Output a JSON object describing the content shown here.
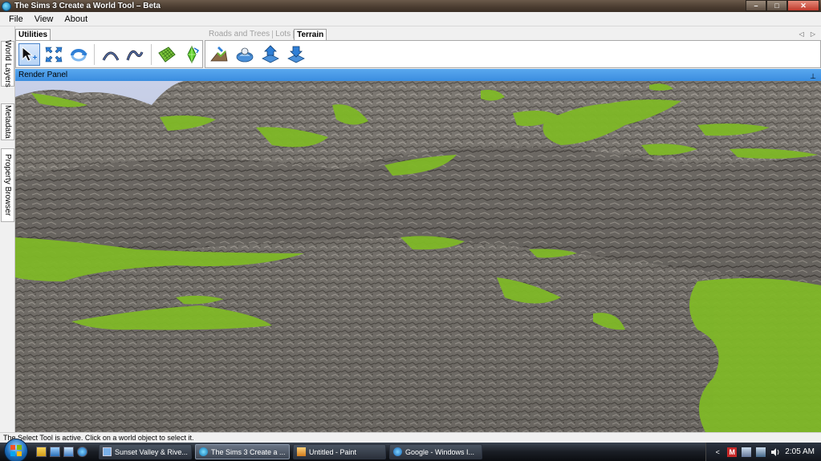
{
  "window": {
    "title": "The Sims 3 Create a World Tool – Beta",
    "controls": {
      "minimize": "–",
      "maximize": "□",
      "close": "✕"
    }
  },
  "menu": {
    "items": [
      "File",
      "View",
      "About"
    ]
  },
  "side_tabs": [
    "World Layers",
    "Metadata",
    "Property Browser"
  ],
  "toolbar": {
    "utilities_tab": "Utilities",
    "tabs": [
      "Roads and Trees",
      "Lots",
      "Terrain"
    ],
    "active_tab": "Terrain",
    "scroll_arrows": "◁ ▷",
    "utility_tools": [
      "select-tool-icon",
      "move-tool-icon",
      "rotate-tool-icon",
      "undo-curve-icon",
      "redo-curve-icon",
      "grid-tool-icon",
      "sim-tool-icon"
    ],
    "terrain_tools": [
      "terrain-sculpt-icon",
      "terrain-smooth-icon",
      "terrain-raise-icon",
      "terrain-lower-icon"
    ]
  },
  "render_panel": {
    "title": "Render Panel",
    "pin": "⊥"
  },
  "status": {
    "text": "The Select Tool is active. Click on a world object to select it."
  },
  "taskbar": {
    "tasks": [
      "Sunset Valley & Rive...",
      "The Sims 3 Create a ...",
      "Untitled - Paint",
      "Google - Windows I..."
    ],
    "active_task": "The Sims 3 Create a ...",
    "tray": {
      "arrow": "<",
      "badge": "M",
      "clock": "2:05 AM"
    }
  },
  "colors": {
    "accent": "#3a8de0",
    "rock": "#7c7872",
    "grass": "#7fb827",
    "sky": "#c8d0e8"
  }
}
